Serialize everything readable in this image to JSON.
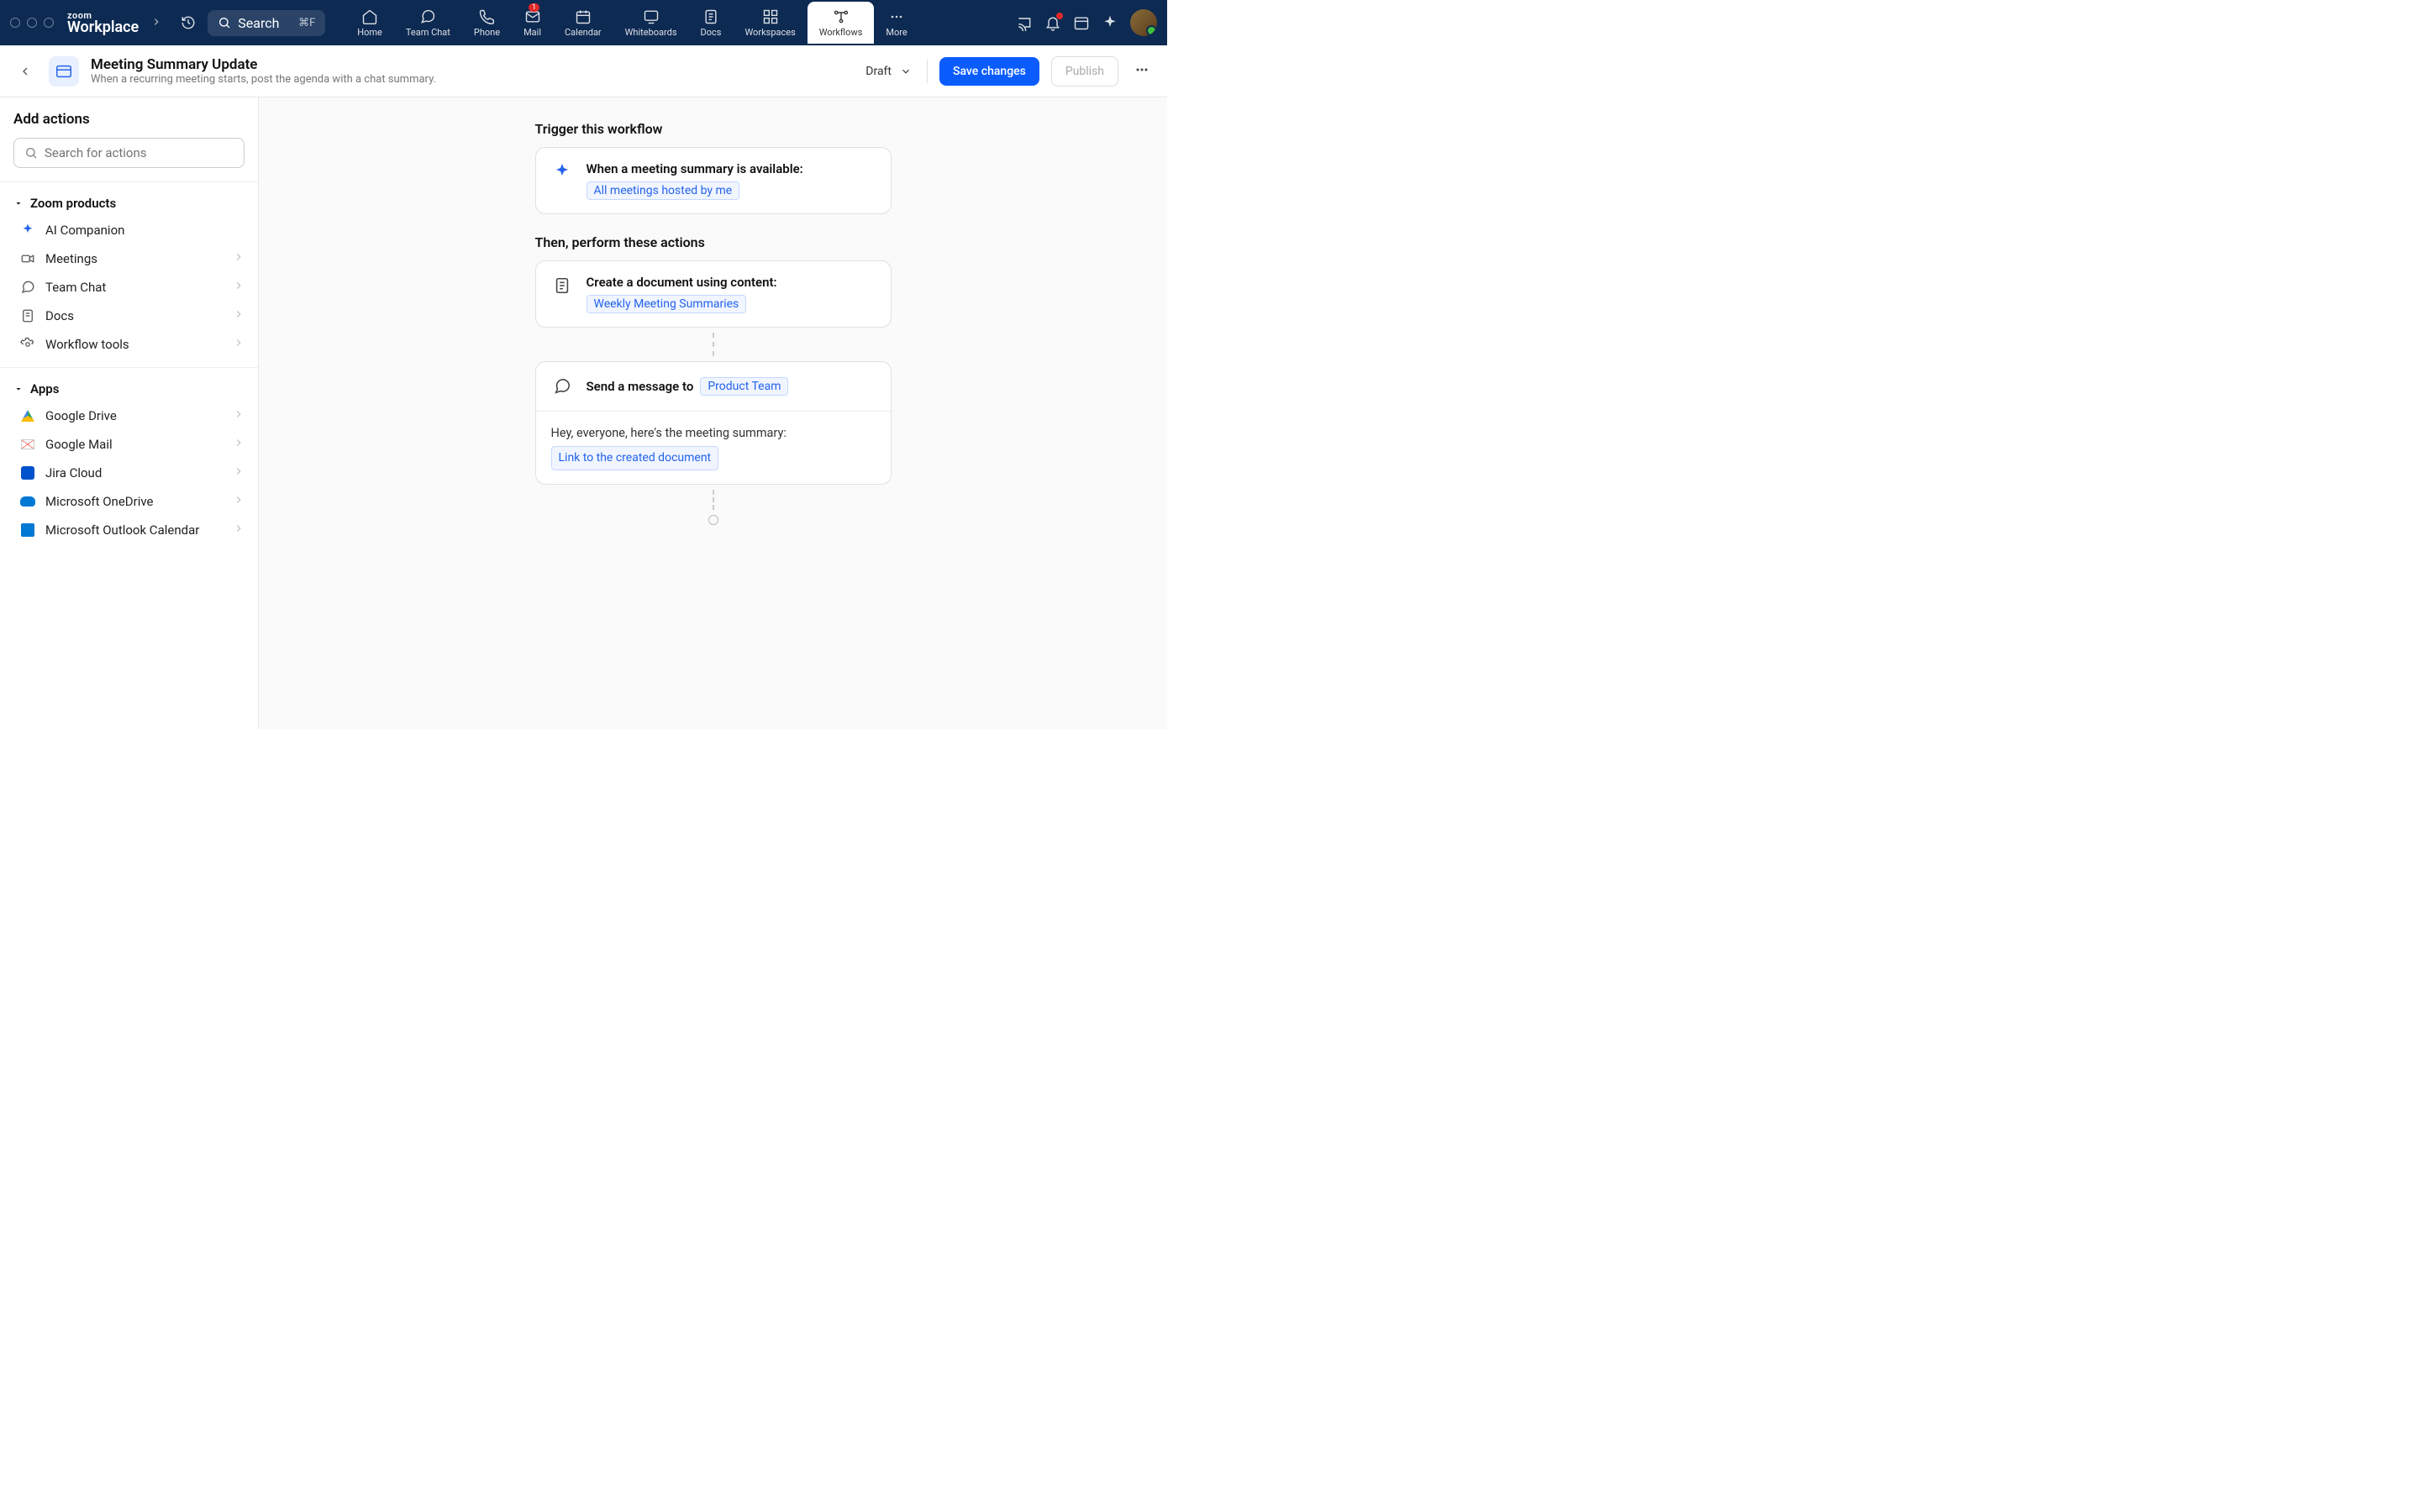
{
  "brand": {
    "line1": "zoom",
    "line2": "Workplace"
  },
  "search": {
    "placeholder": "Search",
    "shortcut": "⌘F"
  },
  "nav": {
    "home": "Home",
    "teamchat": "Team Chat",
    "phone": "Phone",
    "mail": "Mail",
    "mail_badge": "1",
    "calendar": "Calendar",
    "whiteboards": "Whiteboards",
    "docs": "Docs",
    "workspaces": "Workspaces",
    "workflows": "Workflows",
    "more": "More"
  },
  "workflow": {
    "title": "Meeting Summary Update",
    "description": "When a recurring meeting starts, post the agenda with a chat summary.",
    "status": "Draft",
    "save": "Save changes",
    "publish": "Publish"
  },
  "sidebar": {
    "title": "Add actions",
    "search_placeholder": "Search for actions",
    "section_zoom": "Zoom products",
    "zoom_items": {
      "ai": "AI Companion",
      "meetings": "Meetings",
      "teamchat": "Team Chat",
      "docs": "Docs",
      "wftools": "Workflow tools"
    },
    "section_apps": "Apps",
    "app_items": {
      "gdrive": "Google Drive",
      "gmail": "Google Mail",
      "jira": "Jira Cloud",
      "onedrive": "Microsoft OneDrive",
      "outlook": "Microsoft Outlook Calendar"
    }
  },
  "canvas": {
    "trigger_section": "Trigger this workflow",
    "trigger_title": "When a meeting summary is available:",
    "trigger_chip": "All meetings hosted by me",
    "actions_section": "Then, perform these actions",
    "action1_title": "Create a document using content:",
    "action1_chip": "Weekly Meeting Summaries",
    "action2_title": "Send a message to",
    "action2_chip": "Product Team",
    "msg_body": "Hey, everyone, here's the meeting summary:",
    "msg_chip": "Link to the created document"
  }
}
